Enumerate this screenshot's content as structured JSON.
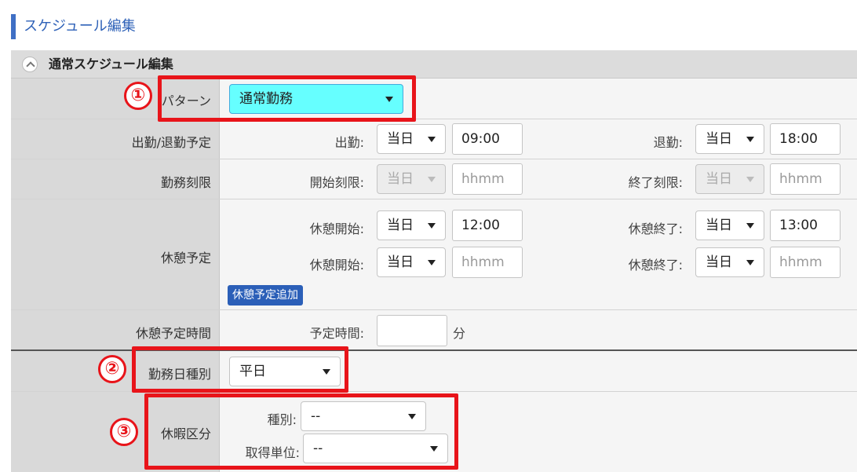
{
  "page_title": "スケジュール編集",
  "section": {
    "title": "通常スケジュール編集",
    "collapse_icon": "chevron-up-icon"
  },
  "pattern": {
    "label": "パターン",
    "value": "通常勤務"
  },
  "schedule": {
    "label": "出勤/退勤予定",
    "start_label": "出勤:",
    "start_day": "当日",
    "start_time": "09:00",
    "end_label": "退勤:",
    "end_day": "当日",
    "end_time": "18:00"
  },
  "limit": {
    "label": "勤務刻限",
    "start_label": "開始刻限:",
    "start_day": "当日",
    "start_placeholder": "hhmm",
    "end_label": "終了刻限:",
    "end_day": "当日",
    "end_placeholder": "hhmm"
  },
  "break": {
    "label": "休憩予定",
    "rows": [
      {
        "start_label": "休憩開始:",
        "start_day": "当日",
        "start_time": "12:00",
        "end_label": "休憩終了:",
        "end_day": "当日",
        "end_time": "13:00"
      },
      {
        "start_label": "休憩開始:",
        "start_day": "当日",
        "start_placeholder": "hhmm",
        "end_label": "休憩終了:",
        "end_day": "当日",
        "end_placeholder": "hhmm"
      }
    ],
    "add_button": "休憩予定追加"
  },
  "break_time": {
    "label": "休憩予定時間",
    "field_label": "予定時間:",
    "value": "",
    "unit": "分"
  },
  "day_type": {
    "label": "勤務日種別",
    "value": "平日"
  },
  "leave": {
    "label": "休暇区分",
    "type_label": "種別:",
    "type_value": "--",
    "unit_label": "取得単位:",
    "unit_value": "--"
  },
  "annotations": [
    "①",
    "②",
    "③"
  ],
  "colors": {
    "annotation_red": "#e8141a",
    "accent_blue": "#2b5fb8",
    "pattern_highlight": "#66ffff"
  }
}
